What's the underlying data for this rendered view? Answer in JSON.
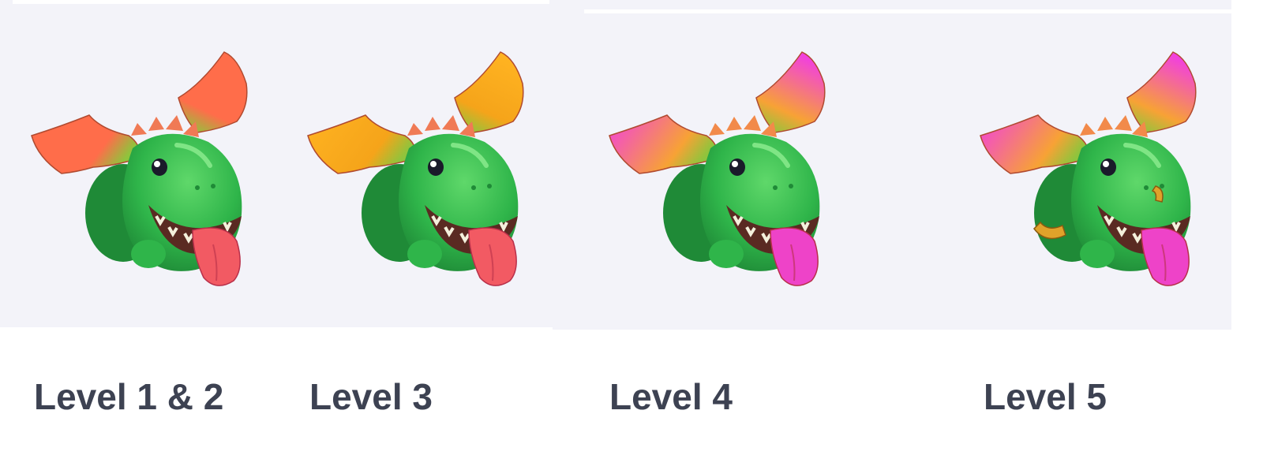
{
  "levels": [
    {
      "label": "Level 1 & 2",
      "icon": "baby-dragon-level-1-2-icon",
      "wing_color_root": "#ff6d4a",
      "wing_color_tip": "#ff6d4a",
      "tongue_color": "#f25a63",
      "horn_color": "#f07a55"
    },
    {
      "label": "Level 3",
      "icon": "baby-dragon-level-3-icon",
      "wing_color_root": "#f5a41a",
      "wing_color_tip": "#ffb321",
      "tongue_color": "#f25a63",
      "horn_color": "#f07a55"
    },
    {
      "label": "Level 4",
      "icon": "baby-dragon-level-4-icon",
      "wing_color_root": "#f7a235",
      "wing_color_tip": "#f23fe0",
      "tongue_color": "#ee43c8",
      "horn_color": "#f28a4a"
    },
    {
      "label": "Level 5",
      "icon": "baby-dragon-level-5-icon",
      "wing_color_root": "#f7a235",
      "wing_color_tip": "#f23fe0",
      "tongue_color": "#ee43c8",
      "horn_color": "#f28a4a",
      "bracelet_color": "#e0a22a"
    }
  ],
  "colors": {
    "panel_background": "#f3f3f9",
    "label_text": "#3d4252",
    "dragon_body": "#2fb54a",
    "dragon_body_dark": "#1f8a37"
  }
}
